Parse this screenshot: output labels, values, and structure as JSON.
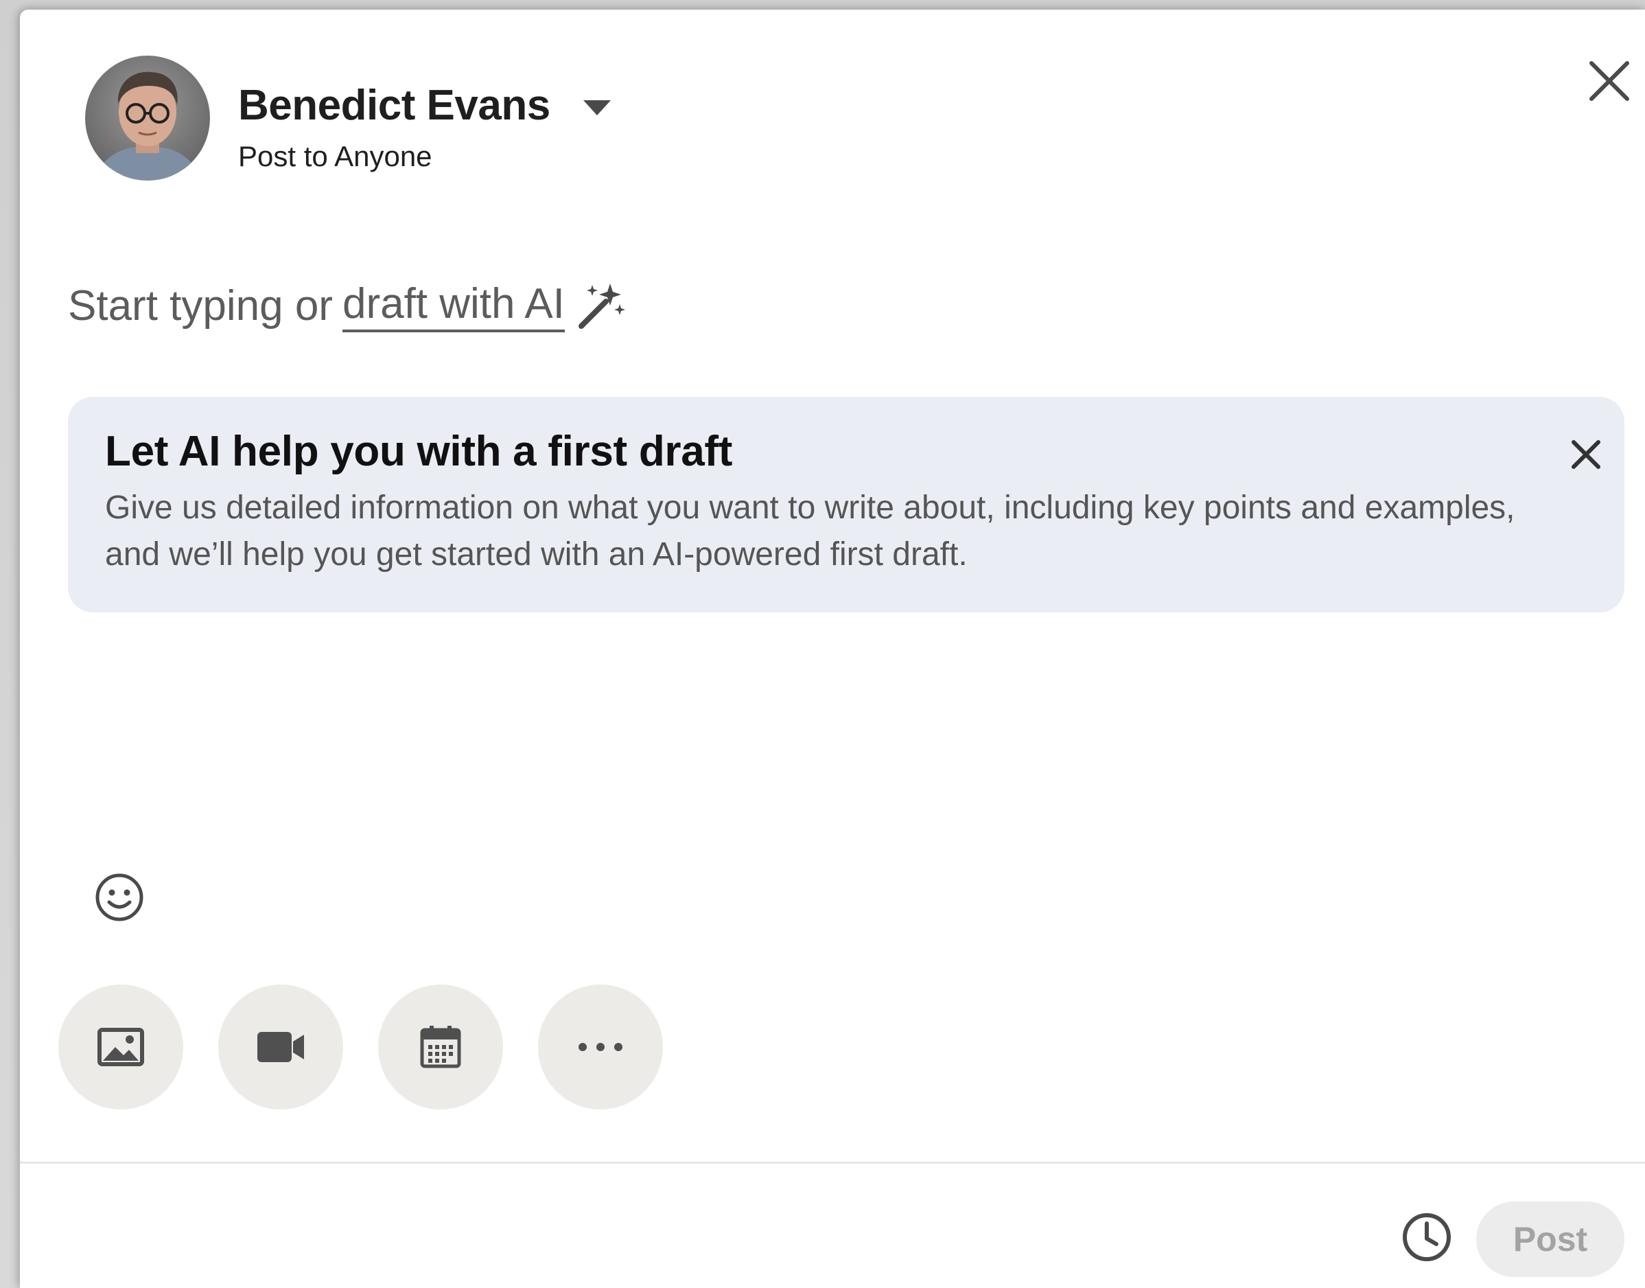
{
  "author": {
    "name": "Benedict Evans",
    "audience": "Post to Anyone"
  },
  "editor": {
    "placeholder_prefix": "Start typing or",
    "draft_link": "draft with AI"
  },
  "ai_card": {
    "title": "Let AI help you with a first draft",
    "body": "Give us detailed information on what you want to write about, including key points and examples, and we’ll help you get started with an AI-powered first draft."
  },
  "toolbar": {
    "items": [
      {
        "icon": "image-icon"
      },
      {
        "icon": "video-icon"
      },
      {
        "icon": "calendar-icon"
      },
      {
        "icon": "more-icon"
      }
    ]
  },
  "footer": {
    "post_label": "Post"
  },
  "colors": {
    "card_background": "#eaeef4",
    "tool_button_background": "#ecebe8",
    "post_button_disabled_bg": "#ececec",
    "post_button_disabled_text": "#a3a3a3"
  }
}
